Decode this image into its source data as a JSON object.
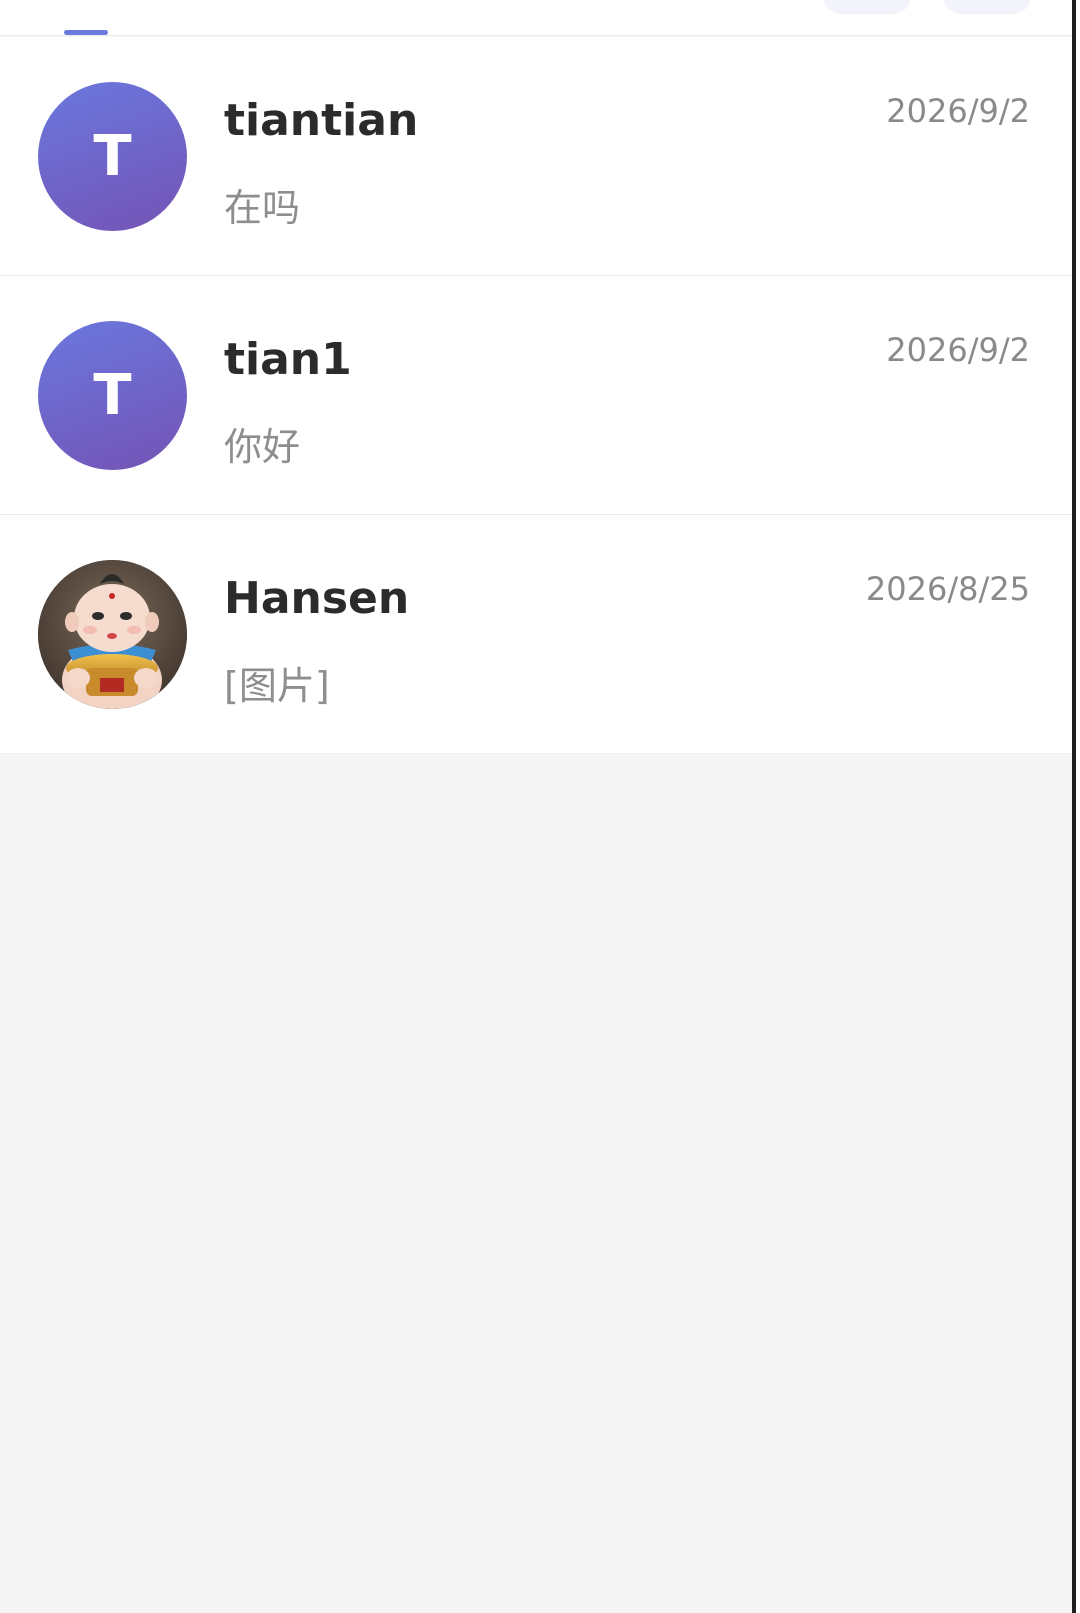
{
  "conversations": [
    {
      "name": "tiantian",
      "preview": "在吗",
      "time": "2026/9/2",
      "avatar_letter": "T"
    },
    {
      "name": "tian1",
      "preview": "你好",
      "time": "2026/9/2",
      "avatar_letter": "T"
    },
    {
      "name": "Hansen",
      "preview": "[图片]",
      "time": "2026/8/25",
      "avatar_letter": ""
    }
  ],
  "colors": {
    "accent": "#6c7ae0",
    "avatar_gradient_start": "#6a78de",
    "avatar_gradient_end": "#7453b5",
    "page_background": "#f5f5f5"
  },
  "icons": {
    "photo_avatar": "doll-avatar-icon"
  }
}
